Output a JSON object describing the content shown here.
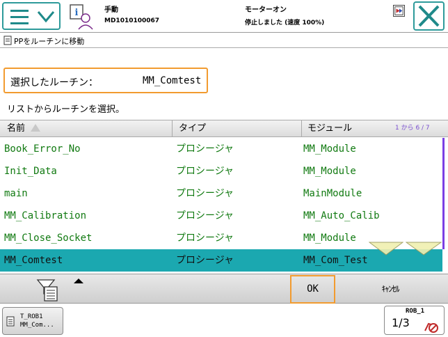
{
  "status": {
    "mode": "手動",
    "controller_id": "MD1010100067",
    "motor": "モーターオン",
    "state": "停止しました (速度 100%)"
  },
  "subheader": {
    "title": "PPをルーチンに移動"
  },
  "selection": {
    "label": "選択したルーチン：",
    "value": "MM_Comtest"
  },
  "instruction": "リストからルーチンを選択。",
  "table": {
    "headers": {
      "name": "名前",
      "type": "タイプ",
      "module": "モジュール"
    },
    "page_info": "1 から 6 / 7",
    "rows": [
      {
        "name": "Book_Error_No",
        "type": "プロシージャ",
        "module": "MM_Module"
      },
      {
        "name": "Init_Data",
        "type": "プロシージャ",
        "module": "MM_Module"
      },
      {
        "name": "main",
        "type": "プロシージャ",
        "module": "MainModule"
      },
      {
        "name": "MM_Calibration",
        "type": "プロシージャ",
        "module": "MM_Auto_Calib"
      },
      {
        "name": "MM_Close_Socket",
        "type": "プロシージャ",
        "module": "MM_Module"
      },
      {
        "name": "MM_Comtest",
        "type": "プロシージャ",
        "module": "MM_Com_Test"
      }
    ],
    "selected_index": 5
  },
  "buttons": {
    "ok": "OK",
    "cancel": "ｷｬﾝｾﾙ"
  },
  "footer": {
    "task_line1": "T_ROB1",
    "task_line2": "MM_Com...",
    "robot_name": "ROB_1",
    "speed": "1/3"
  },
  "colors": {
    "accent_teal": "#2d9a9a",
    "selection_row": "#1ba8b0",
    "highlight_orange": "#f29b2f",
    "text_green": "#117a11",
    "scrollbar": "#7b3fe4"
  },
  "icons": {
    "menu": "hamburger-chevron-icon",
    "info": "info-user-icon",
    "close": "close-x-icon",
    "filter": "filter-icon",
    "task": "program-task-icon",
    "robot_stop": "robot-stop-icon"
  }
}
